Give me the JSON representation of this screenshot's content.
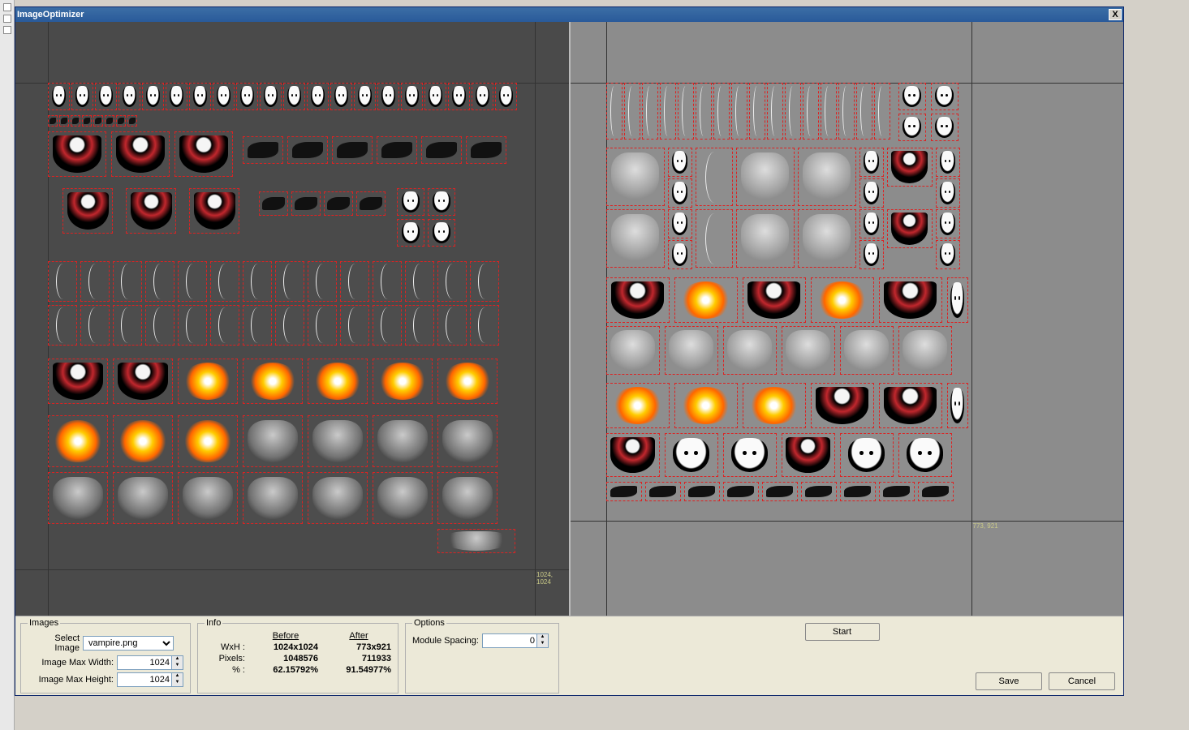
{
  "window": {
    "title": "ImageOptimizer",
    "close": "X"
  },
  "panels": {
    "images": {
      "legend": "Images",
      "select_label": "Select Image",
      "select_value": "vampire.png",
      "maxw_label": "Image Max Width:",
      "maxw_value": "1024",
      "maxh_label": "Image Max Height:",
      "maxh_value": "1024"
    },
    "info": {
      "legend": "Info",
      "before": "Before",
      "after": "After",
      "wxh_label": "WxH :",
      "wxh_before": "1024x1024",
      "wxh_after": "773x921",
      "pixels_label": "Pixels:",
      "pixels_before": "1048576",
      "pixels_after": "711933",
      "pct_label": "% :",
      "pct_before": "62.15792%",
      "pct_after": "91.54977%"
    },
    "options": {
      "legend": "Options",
      "spacing_label": "Module Spacing:",
      "spacing_value": "0"
    }
  },
  "buttons": {
    "start": "Start",
    "save": "Save",
    "cancel": "Cancel"
  },
  "canvas": {
    "left_dim": "1024, 1024",
    "right_dim": "773, 921"
  }
}
